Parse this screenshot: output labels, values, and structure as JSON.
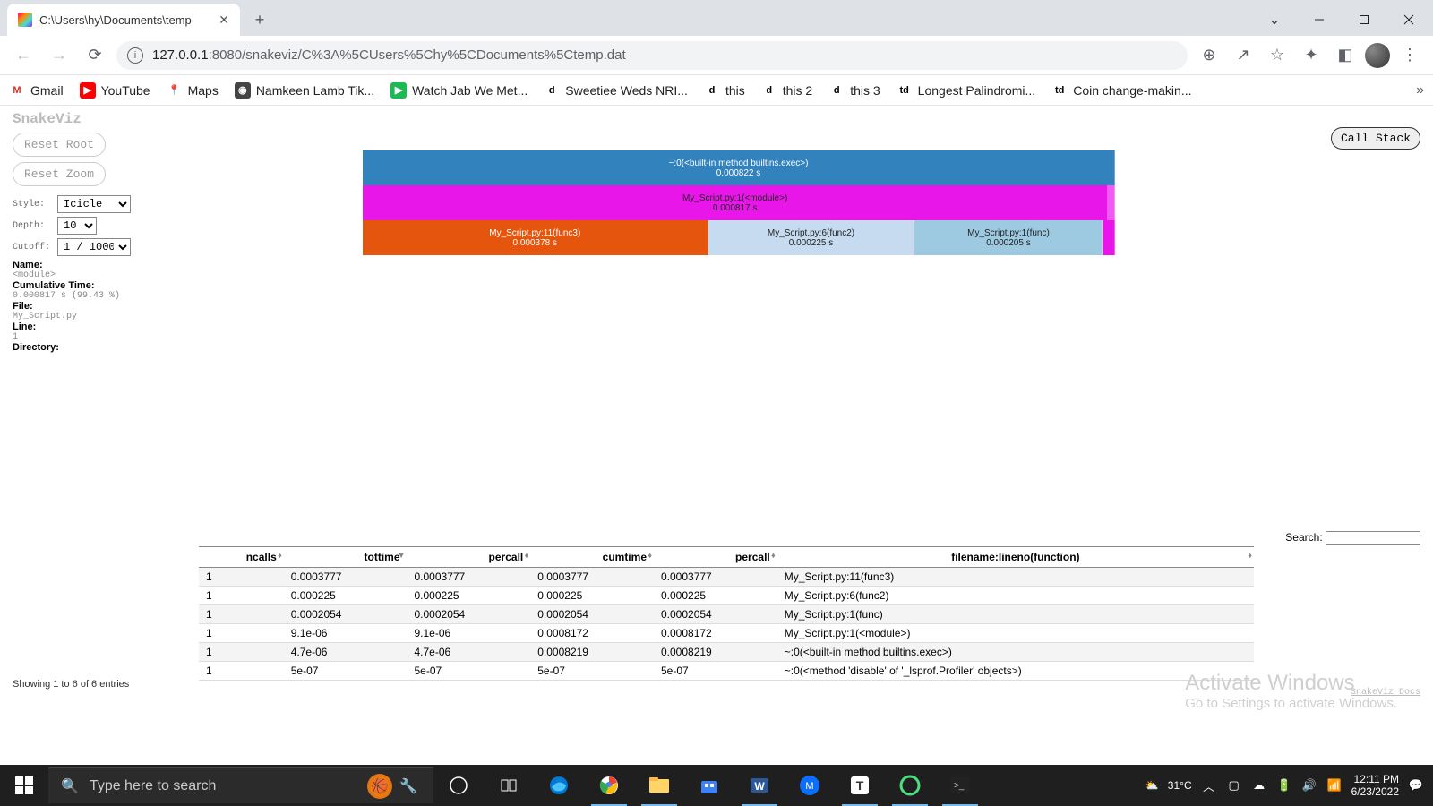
{
  "browser": {
    "tab_title": "C:\\Users\\hy\\Documents\\temp",
    "url_host": "127.0.0.1",
    "url_port": ":8080",
    "url_path": "/snakeviz/C%3A%5CUsers%5Chy%5CDocuments%5Ctemp.dat",
    "search_placeholder": "Type here to search"
  },
  "bookmarks": [
    {
      "label": "Gmail",
      "icon_bg": "#fff",
      "icon_fg": "#d93025",
      "glyph": "M"
    },
    {
      "label": "YouTube",
      "icon_bg": "#ff0000",
      "icon_fg": "#fff",
      "glyph": "▶"
    },
    {
      "label": "Maps",
      "icon_bg": "#fff",
      "icon_fg": "#34a853",
      "glyph": "📍"
    },
    {
      "label": "Namkeen Lamb Tik...",
      "icon_bg": "#444",
      "icon_fg": "#fff",
      "glyph": "◉"
    },
    {
      "label": "Watch Jab We Met...",
      "icon_bg": "#1db954",
      "icon_fg": "#fff",
      "glyph": "▶"
    },
    {
      "label": "Sweetiee Weds NRI...",
      "icon_bg": "#fff",
      "icon_fg": "#000",
      "glyph": "d"
    },
    {
      "label": "this",
      "icon_bg": "#fff",
      "icon_fg": "#000",
      "glyph": "d"
    },
    {
      "label": "this 2",
      "icon_bg": "#fff",
      "icon_fg": "#000",
      "glyph": "d"
    },
    {
      "label": "this 3",
      "icon_bg": "#fff",
      "icon_fg": "#000",
      "glyph": "d"
    },
    {
      "label": "Longest Palindromi...",
      "icon_bg": "#fff",
      "icon_fg": "#000",
      "glyph": "td"
    },
    {
      "label": "Coin change-makin...",
      "icon_bg": "#fff",
      "icon_fg": "#000",
      "glyph": "td"
    }
  ],
  "snakeviz": {
    "title": "SnakeViz",
    "reset_root": "Reset Root",
    "reset_zoom": "Reset Zoom",
    "call_stack": "Call Stack",
    "style_label": "Style:",
    "depth_label": "Depth:",
    "cutoff_label": "Cutoff:",
    "style_value": "Icicle",
    "depth_value": "10",
    "cutoff_value": "1 / 1000",
    "info": {
      "name_k": "Name:",
      "name_v": "<module>",
      "ct_k": "Cumulative Time:",
      "ct_v": "0.000817 s (99.43 %)",
      "file_k": "File:",
      "file_v": "My_Script.py",
      "line_k": "Line:",
      "line_v": "1",
      "dir_k": "Directory:"
    },
    "search_label": "Search:",
    "entries_info": "Showing 1 to 6 of 6 entries",
    "docs_link": "SnakeViz Docs"
  },
  "icicle": {
    "r0": {
      "label": "~:0(<built-in method builtins.exec>)",
      "time": "0.000822 s"
    },
    "r1": {
      "label": "My_Script.py:1(<module>)",
      "time": "0.000817 s"
    },
    "r2a": {
      "label": "My_Script.py:11(func3)",
      "time": "0.000378 s"
    },
    "r2b": {
      "label": "My_Script.py:6(func2)",
      "time": "0.000225 s"
    },
    "r2c": {
      "label": "My_Script.py:1(func)",
      "time": "0.000205 s"
    }
  },
  "table": {
    "headers": [
      "ncalls",
      "tottime",
      "percall",
      "cumtime",
      "percall",
      "filename:lineno(function)"
    ],
    "rows": [
      [
        "1",
        "0.0003777",
        "0.0003777",
        "0.0003777",
        "0.0003777",
        "My_Script.py:11(func3)"
      ],
      [
        "1",
        "0.000225",
        "0.000225",
        "0.000225",
        "0.000225",
        "My_Script.py:6(func2)"
      ],
      [
        "1",
        "0.0002054",
        "0.0002054",
        "0.0002054",
        "0.0002054",
        "My_Script.py:1(func)"
      ],
      [
        "1",
        "9.1e-06",
        "9.1e-06",
        "0.0008172",
        "0.0008172",
        "My_Script.py:1(<module>)"
      ],
      [
        "1",
        "4.7e-06",
        "4.7e-06",
        "0.0008219",
        "0.0008219",
        "~:0(<built-in method builtins.exec>)"
      ],
      [
        "1",
        "5e-07",
        "5e-07",
        "5e-07",
        "5e-07",
        "~:0(<method 'disable' of '_lsprof.Profiler' objects>)"
      ]
    ]
  },
  "watermark": {
    "h": "Activate Windows",
    "s": "Go to Settings to activate Windows."
  },
  "systray": {
    "temp": "31°C",
    "time": "12:11 PM",
    "date": "6/23/2022"
  }
}
